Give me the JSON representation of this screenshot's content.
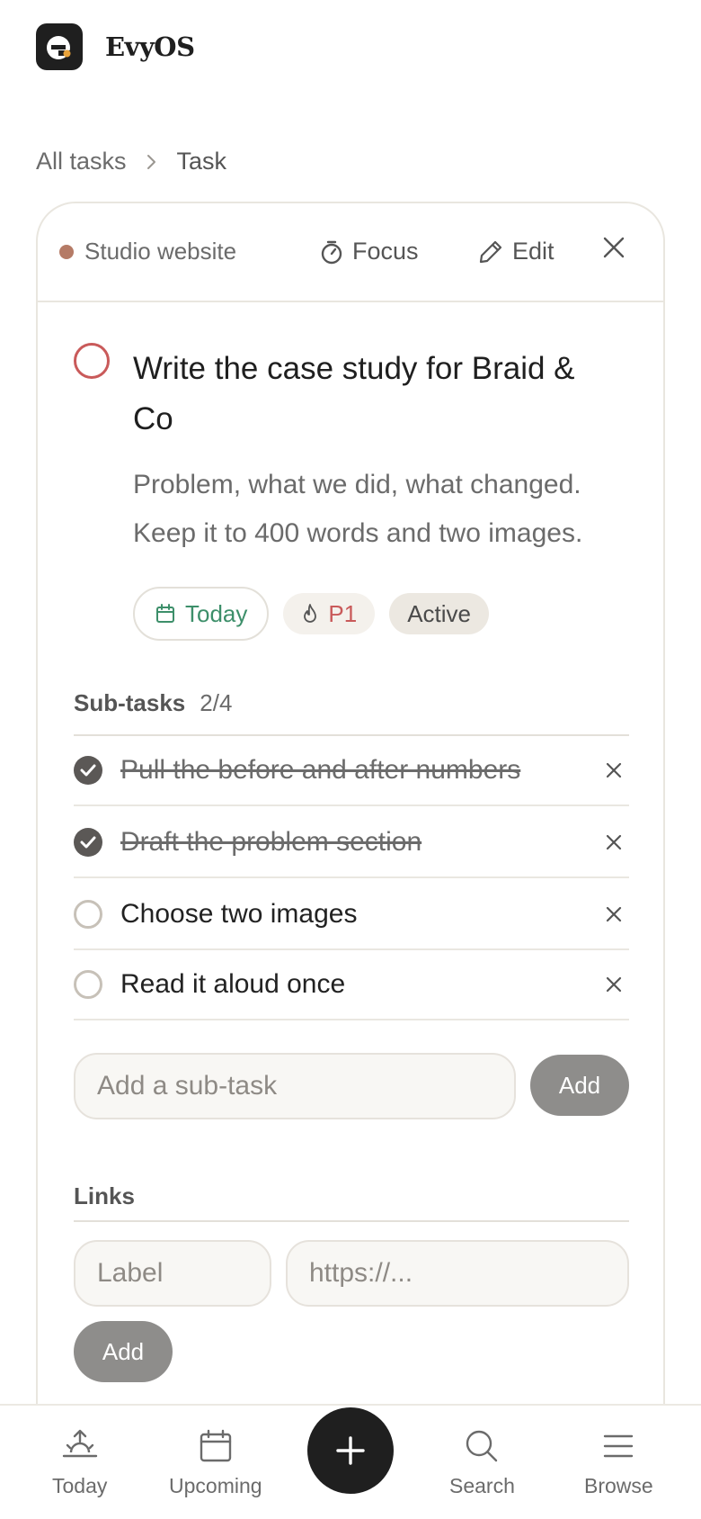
{
  "app": {
    "name": "EvyOS",
    "logo_letter": "e"
  },
  "breadcrumb": {
    "parent": "All tasks",
    "current": "Task"
  },
  "task": {
    "project": "Studio website",
    "project_color": "#b57b66",
    "actions": {
      "focus": "Focus",
      "edit": "Edit"
    },
    "title": "Write the case study for Braid & Co",
    "description": "Problem, what we did, what changed. Keep it to 400 words and two images.",
    "chips": {
      "date": "Today",
      "priority": "P1",
      "status": "Active"
    }
  },
  "subtasks": {
    "label": "Sub-tasks",
    "count": "2/4",
    "items": [
      {
        "text": "Pull the before and after numbers",
        "done": true
      },
      {
        "text": "Draft the problem section",
        "done": true
      },
      {
        "text": "Choose two images",
        "done": false
      },
      {
        "text": "Read it aloud once",
        "done": false
      }
    ],
    "input_placeholder": "Add a sub-task",
    "add_label": "Add"
  },
  "links": {
    "label": "Links",
    "label_placeholder": "Label",
    "url_placeholder": "https://...",
    "add_label": "Add"
  },
  "nav": {
    "today": "Today",
    "upcoming": "Upcoming",
    "search": "Search",
    "browse": "Browse"
  },
  "colors": {
    "accent_green": "#3d8f6a",
    "priority_red": "#c95a5a",
    "fab": "#1f1f1f"
  }
}
